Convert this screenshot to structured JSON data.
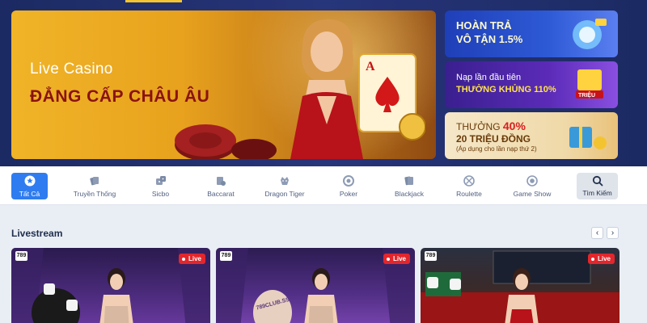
{
  "hero": {
    "subtitle": "Live Casino",
    "title": "ĐẲNG CẤP CHÂU ÂU",
    "card_letter": "A"
  },
  "promos": [
    {
      "line1": "HOÀN TRẢ",
      "line2": "VÔ TẬN 1.5%"
    },
    {
      "line1": "Nạp lần đầu tiên",
      "line2": "THƯỞNG KHỦNG 110%",
      "art_text": "TRIỆU"
    },
    {
      "line1_prefix": "THƯỞNG",
      "line1_pct": "40%",
      "line2": "20 TRIỆU ĐỒNG",
      "line3": "(Áp dụng cho lần nạp thứ 2)"
    }
  ],
  "categories": [
    {
      "label": "Tất Cả",
      "icon": "star-icon"
    },
    {
      "label": "Truyền Thống",
      "icon": "cards-icon"
    },
    {
      "label": "Sicbo",
      "icon": "dice-icon"
    },
    {
      "label": "Baccarat",
      "icon": "baccarat-icon"
    },
    {
      "label": "Dragon Tiger",
      "icon": "dragon-icon"
    },
    {
      "label": "Poker",
      "icon": "poker-chip-icon"
    },
    {
      "label": "Blackjack",
      "icon": "blackjack-icon"
    },
    {
      "label": "Roulette",
      "icon": "roulette-icon"
    },
    {
      "label": "Game Show",
      "icon": "gameshow-icon"
    }
  ],
  "search": {
    "label": "Tìm Kiếm",
    "icon": "search-icon"
  },
  "livestream": {
    "title": "Livestream",
    "prev": "‹",
    "next": "›",
    "cards": [
      {
        "brand": "789",
        "badge": "Live"
      },
      {
        "brand": "789",
        "badge": "Live",
        "sign": "789CLUB.SS"
      },
      {
        "brand": "789",
        "badge": "Live"
      }
    ]
  },
  "colors": {
    "accent": "#2f7cf0",
    "live_red": "#e3262c",
    "hero_gold": "#f0b428",
    "hero_title": "#8a1212"
  }
}
